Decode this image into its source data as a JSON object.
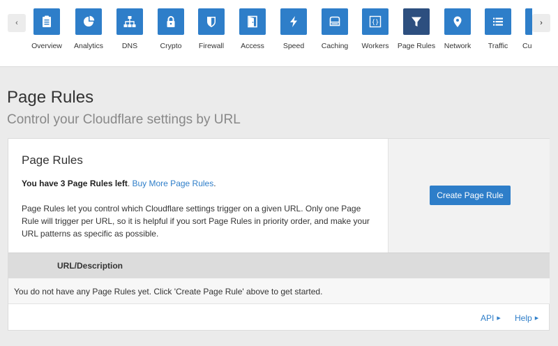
{
  "nav": {
    "prev_glyph": "‹",
    "next_glyph": "›",
    "items": [
      {
        "label": "Overview",
        "icon": "clipboard-icon"
      },
      {
        "label": "Analytics",
        "icon": "pie-chart-icon"
      },
      {
        "label": "DNS",
        "icon": "network-tree-icon"
      },
      {
        "label": "Crypto",
        "icon": "lock-icon"
      },
      {
        "label": "Firewall",
        "icon": "shield-icon"
      },
      {
        "label": "Access",
        "icon": "door-icon"
      },
      {
        "label": "Speed",
        "icon": "lightning-icon"
      },
      {
        "label": "Caching",
        "icon": "server-icon"
      },
      {
        "label": "Workers",
        "icon": "braces-icon"
      },
      {
        "label": "Page Rules",
        "icon": "funnel-icon",
        "active": true
      },
      {
        "label": "Network",
        "icon": "map-pin-icon"
      },
      {
        "label": "Traffic",
        "icon": "list-icon"
      },
      {
        "label": "Cu",
        "icon": "custom-icon"
      }
    ]
  },
  "page": {
    "title": "Page Rules",
    "subtitle": "Control your Cloudflare settings by URL"
  },
  "card": {
    "title": "Page Rules",
    "rules_left_bold": "You have 3 Page Rules left",
    "rules_left_sep": ". ",
    "buy_more": "Buy More Page Rules",
    "rules_left_end": ".",
    "description": "Page Rules let you control which Cloudflare settings trigger on a given URL. Only one Page Rule will trigger per URL, so it is helpful if you sort Page Rules in priority order, and make your URL patterns as specific as possible.",
    "create_button": "Create Page Rule"
  },
  "table": {
    "column_header": "URL/Description",
    "empty_message": "You do not have any Page Rules yet. Click 'Create Page Rule' above to get started."
  },
  "footer": {
    "api_link": "API",
    "help_link": "Help",
    "caret": "▶"
  },
  "colors": {
    "accent": "#2e7ec9",
    "active_nav": "#2d4f7f",
    "background": "#ebebeb"
  }
}
